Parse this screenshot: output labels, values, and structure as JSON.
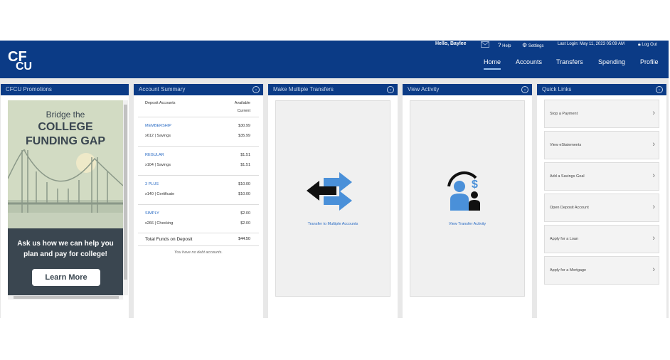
{
  "topbar": {
    "greeting": "Hello, Baylee",
    "help": "Help",
    "settings": "Settings",
    "last_login": "Last Login: May 11, 2023 05:09 AM",
    "logout": "Log Out"
  },
  "nav": [
    "Home",
    "Accounts",
    "Transfers",
    "Spending",
    "Profile"
  ],
  "panels": {
    "promotions": "CFCU Promotions",
    "account_summary": "Account Summary",
    "multiple_transfers": "Make Multiple Transfers",
    "view_activity": "View Activity",
    "quick_links": "Quick Links"
  },
  "promo": {
    "headline1": "Bridge the",
    "headline2": "COLLEGE",
    "headline3": "FUNDING GAP",
    "body1": "Ask us how we can help you",
    "body2": "plan and pay for college!",
    "button": "Learn More"
  },
  "summary": {
    "col_left": "Deposit Accounts",
    "col_right1": "Available",
    "col_right2": "Current",
    "accounts": [
      {
        "name": "MEMBERSHIP",
        "detail": "x612 | Savings",
        "available": "$30.99",
        "current": "$35.99"
      },
      {
        "name": "REGULAR",
        "detail": "x104 | Savings",
        "available": "$1.51",
        "current": "$1.51"
      },
      {
        "name": "3 PLUS",
        "detail": "x140 | Certificate",
        "available": "$10.00",
        "current": "$10.00"
      },
      {
        "name": "SIMPLY",
        "detail": "x266 | Checking",
        "available": "$2.00",
        "current": "$2.00"
      }
    ],
    "total_label": "Total Funds on Deposit",
    "total_value": "$44.50",
    "no_debt": "You have no debt accounts."
  },
  "transfer_link": "Transfer to Multiple Accounts",
  "activity_link": "View Transfer Activity",
  "quick_links": [
    "Stop a Payment",
    "View eStatements",
    "Add a Savings Goal",
    "Open Deposit Account",
    "Apply for a Loan",
    "Apply for a Mortgage"
  ],
  "colors": {
    "brand": "#0b3b86",
    "link": "#2b6cc4",
    "arrow_blue": "#4a90d9"
  }
}
